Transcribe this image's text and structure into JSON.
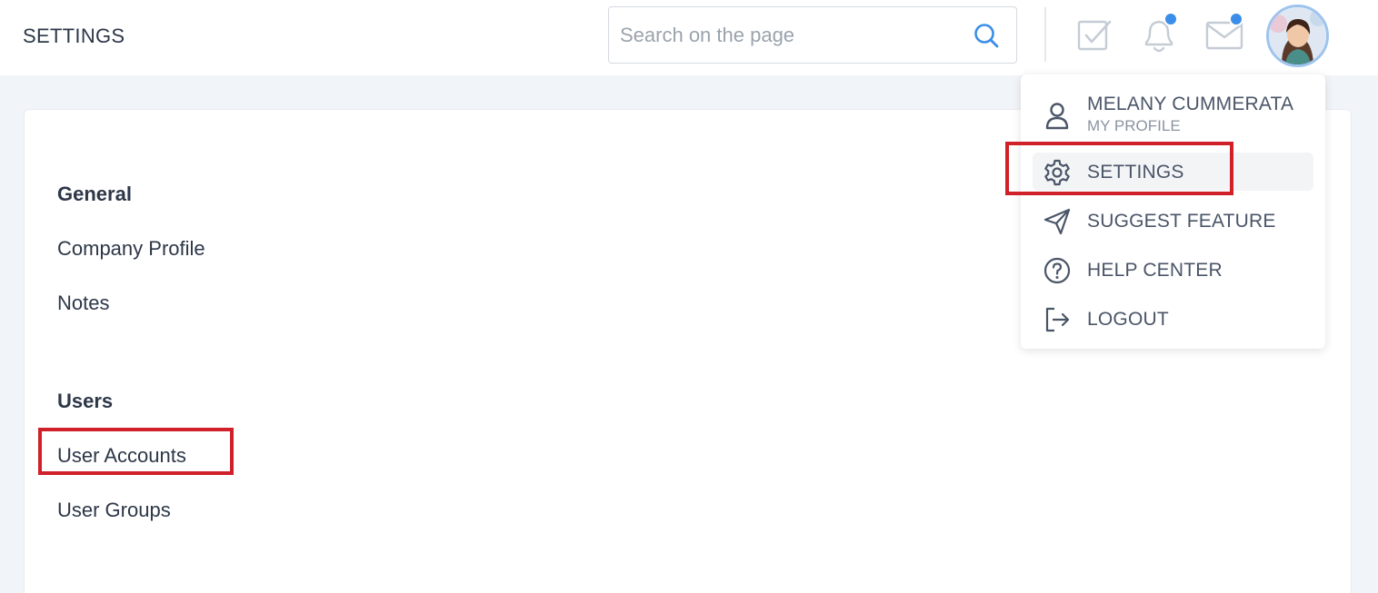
{
  "header": {
    "title": "SETTINGS",
    "search": {
      "placeholder": "Search on the page",
      "value": ""
    },
    "icons": [
      "search-icon",
      "tasks-icon",
      "bell-icon",
      "mail-icon"
    ],
    "notification_dot_color": "#3b8ee8"
  },
  "sidebar": {
    "sections": [
      {
        "title": "General",
        "items": [
          "Company Profile",
          "Notes"
        ]
      },
      {
        "title": "Users",
        "items": [
          "User Accounts",
          "User Groups"
        ]
      }
    ]
  },
  "profile_menu": {
    "user_name": "MELANY CUMMERATA",
    "user_sub": "MY PROFILE",
    "items": [
      {
        "label": "SETTINGS",
        "icon": "gear-icon",
        "active": true
      },
      {
        "label": "SUGGEST FEATURE",
        "icon": "send-icon"
      },
      {
        "label": "HELP CENTER",
        "icon": "help-icon"
      },
      {
        "label": "LOGOUT",
        "icon": "logout-icon"
      }
    ]
  },
  "colors": {
    "accent": "#3b8ee8",
    "highlight_box": "#d0202a",
    "background": "#f1f4f8"
  }
}
